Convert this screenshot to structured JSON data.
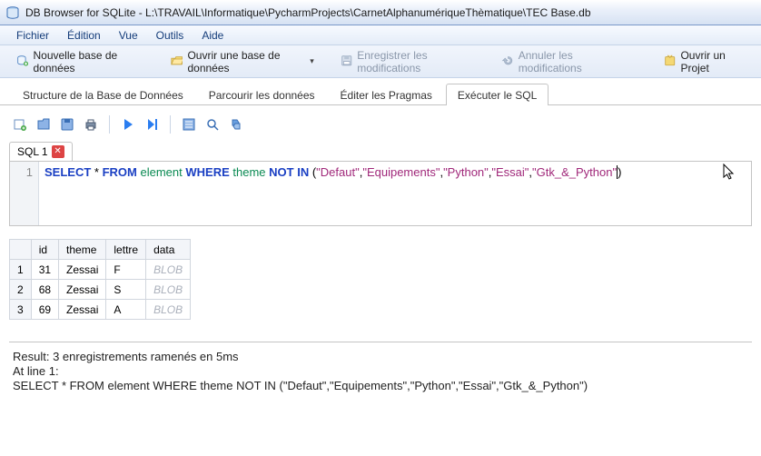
{
  "window": {
    "title": "DB Browser for SQLite - L:\\TRAVAIL\\Informatique\\PycharmProjects\\CarnetAlphanumériqueThèmatique\\TEC Base.db"
  },
  "menubar": {
    "file": "Fichier",
    "edit": "Édition",
    "view": "Vue",
    "tools": "Outils",
    "help": "Aide"
  },
  "toolbar": {
    "new_db": "Nouvelle base de données",
    "open_db": "Ouvrir une base de données",
    "write_changes": "Enregistrer les modifications",
    "revert_changes": "Annuler les modifications",
    "open_project": "Ouvrir un Projet"
  },
  "tabs": {
    "structure": "Structure de la Base de Données",
    "browse": "Parcourir les données",
    "pragmas": "Éditer les Pragmas",
    "execute": "Exécuter le SQL"
  },
  "sql": {
    "tab_label": "SQL 1",
    "line_no": "1",
    "tokens": {
      "select": "SELECT",
      "star": " * ",
      "from": "FROM",
      "sp": " ",
      "element": "element",
      "where": "WHERE",
      "theme": "theme",
      "notin": "NOT IN",
      "open": " (",
      "s1": "\"Defaut\"",
      "c": ",",
      "s2": "\"Equipements\"",
      "s3": "\"Python\"",
      "s4": "\"Essai\"",
      "s5": "\"Gtk_&_Python\"",
      "close": ")"
    }
  },
  "results": {
    "headers": {
      "id": "id",
      "theme": "theme",
      "lettre": "lettre",
      "data": "data"
    },
    "rows": [
      {
        "n": "1",
        "id": "31",
        "theme": "Zessai",
        "lettre": "F",
        "data": "BLOB"
      },
      {
        "n": "2",
        "id": "68",
        "theme": "Zessai",
        "lettre": "S",
        "data": "BLOB"
      },
      {
        "n": "3",
        "id": "69",
        "theme": "Zessai",
        "lettre": "A",
        "data": "BLOB"
      }
    ]
  },
  "output": {
    "line1": "Result: 3 enregistrements ramenés en 5ms",
    "line2": "At line 1:",
    "line3": "SELECT * FROM element WHERE theme NOT IN (\"Defaut\",\"Equipements\",\"Python\",\"Essai\",\"Gtk_&_Python\")"
  }
}
